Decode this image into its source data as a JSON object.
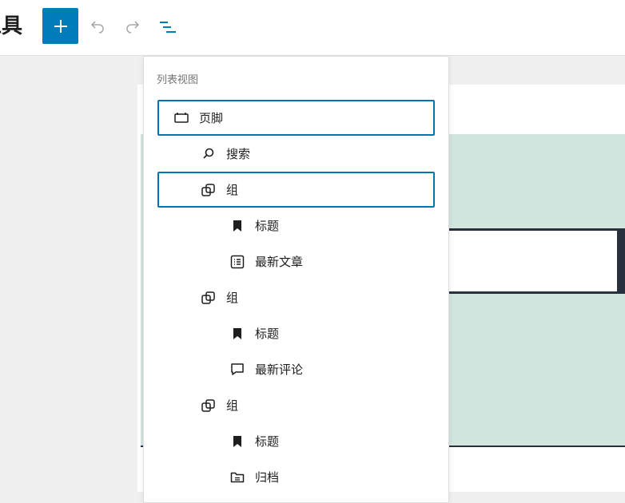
{
  "header": {
    "title_fragment": "工具",
    "add_label": "+"
  },
  "panel": {
    "title": "列表视图",
    "items": [
      {
        "label": "页脚",
        "icon": "footer-icon",
        "selected": true
      },
      {
        "label": "搜索",
        "icon": "search-icon",
        "selected": false
      },
      {
        "label": "组",
        "icon": "group-icon",
        "selected": true
      },
      {
        "label": "标题",
        "icon": "heading-bookmark-icon",
        "selected": false
      },
      {
        "label": "最新文章",
        "icon": "latest-posts-icon",
        "selected": false
      },
      {
        "label": "组",
        "icon": "group-icon",
        "selected": false
      },
      {
        "label": "标题",
        "icon": "heading-bookmark-icon",
        "selected": false
      },
      {
        "label": "最新评论",
        "icon": "comment-icon",
        "selected": false
      },
      {
        "label": "组",
        "icon": "group-icon",
        "selected": false
      },
      {
        "label": "标题",
        "icon": "heading-bookmark-icon",
        "selected": false
      },
      {
        "label": "归档",
        "icon": "archive-folder-icon",
        "selected": false
      }
    ]
  },
  "colors": {
    "accent": "#007cba",
    "canvas_green": "#d1e4dd",
    "dark": "#28303d"
  }
}
